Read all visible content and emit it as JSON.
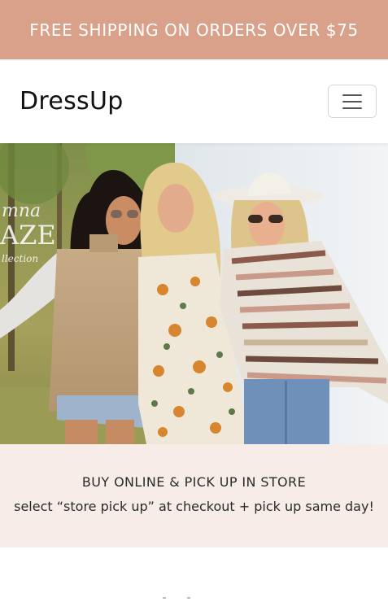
{
  "promo": {
    "text": "FREE SHIPPING ON ORDERS OVER $75"
  },
  "navbar": {
    "brand": "DressUp",
    "menu_icon": "hamburger-menu-icon"
  },
  "hero": {
    "image": "three-women-fall-fashion-photo",
    "overlay_lines": [
      "mna",
      "AZE",
      "llection"
    ]
  },
  "pickup": {
    "title": "BUY ONLINE & PICK UP IN STORE",
    "subtitle": "select “store pick up” at checkout + pick up same day!"
  },
  "colors": {
    "promo_bg": "#d9a08a",
    "pickup_bg": "#f8ece8"
  }
}
